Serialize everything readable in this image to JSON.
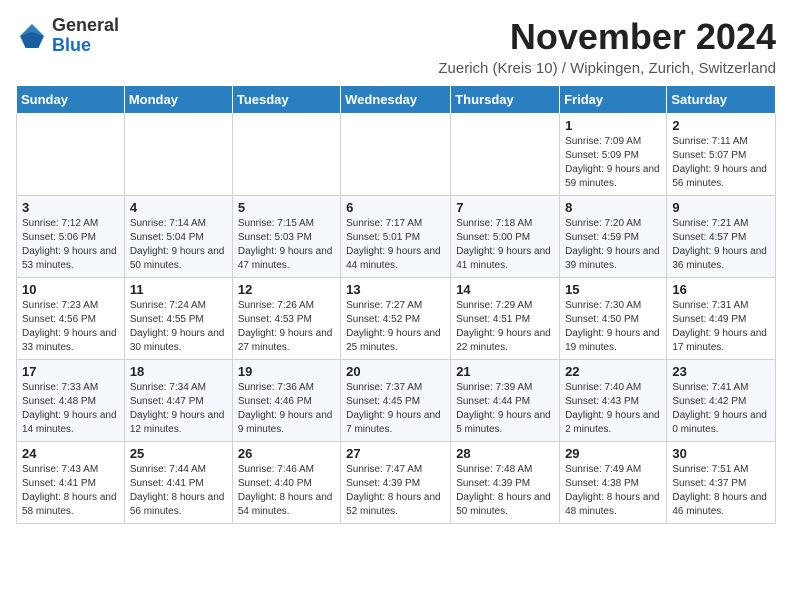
{
  "header": {
    "logo_general": "General",
    "logo_blue": "Blue",
    "month_title": "November 2024",
    "subtitle": "Zuerich (Kreis 10) / Wipkingen, Zurich, Switzerland"
  },
  "days_of_week": [
    "Sunday",
    "Monday",
    "Tuesday",
    "Wednesday",
    "Thursday",
    "Friday",
    "Saturday"
  ],
  "weeks": [
    [
      {
        "day": "",
        "info": ""
      },
      {
        "day": "",
        "info": ""
      },
      {
        "day": "",
        "info": ""
      },
      {
        "day": "",
        "info": ""
      },
      {
        "day": "",
        "info": ""
      },
      {
        "day": "1",
        "info": "Sunrise: 7:09 AM\nSunset: 5:09 PM\nDaylight: 9 hours and 59 minutes."
      },
      {
        "day": "2",
        "info": "Sunrise: 7:11 AM\nSunset: 5:07 PM\nDaylight: 9 hours and 56 minutes."
      }
    ],
    [
      {
        "day": "3",
        "info": "Sunrise: 7:12 AM\nSunset: 5:06 PM\nDaylight: 9 hours and 53 minutes."
      },
      {
        "day": "4",
        "info": "Sunrise: 7:14 AM\nSunset: 5:04 PM\nDaylight: 9 hours and 50 minutes."
      },
      {
        "day": "5",
        "info": "Sunrise: 7:15 AM\nSunset: 5:03 PM\nDaylight: 9 hours and 47 minutes."
      },
      {
        "day": "6",
        "info": "Sunrise: 7:17 AM\nSunset: 5:01 PM\nDaylight: 9 hours and 44 minutes."
      },
      {
        "day": "7",
        "info": "Sunrise: 7:18 AM\nSunset: 5:00 PM\nDaylight: 9 hours and 41 minutes."
      },
      {
        "day": "8",
        "info": "Sunrise: 7:20 AM\nSunset: 4:59 PM\nDaylight: 9 hours and 39 minutes."
      },
      {
        "day": "9",
        "info": "Sunrise: 7:21 AM\nSunset: 4:57 PM\nDaylight: 9 hours and 36 minutes."
      }
    ],
    [
      {
        "day": "10",
        "info": "Sunrise: 7:23 AM\nSunset: 4:56 PM\nDaylight: 9 hours and 33 minutes."
      },
      {
        "day": "11",
        "info": "Sunrise: 7:24 AM\nSunset: 4:55 PM\nDaylight: 9 hours and 30 minutes."
      },
      {
        "day": "12",
        "info": "Sunrise: 7:26 AM\nSunset: 4:53 PM\nDaylight: 9 hours and 27 minutes."
      },
      {
        "day": "13",
        "info": "Sunrise: 7:27 AM\nSunset: 4:52 PM\nDaylight: 9 hours and 25 minutes."
      },
      {
        "day": "14",
        "info": "Sunrise: 7:29 AM\nSunset: 4:51 PM\nDaylight: 9 hours and 22 minutes."
      },
      {
        "day": "15",
        "info": "Sunrise: 7:30 AM\nSunset: 4:50 PM\nDaylight: 9 hours and 19 minutes."
      },
      {
        "day": "16",
        "info": "Sunrise: 7:31 AM\nSunset: 4:49 PM\nDaylight: 9 hours and 17 minutes."
      }
    ],
    [
      {
        "day": "17",
        "info": "Sunrise: 7:33 AM\nSunset: 4:48 PM\nDaylight: 9 hours and 14 minutes."
      },
      {
        "day": "18",
        "info": "Sunrise: 7:34 AM\nSunset: 4:47 PM\nDaylight: 9 hours and 12 minutes."
      },
      {
        "day": "19",
        "info": "Sunrise: 7:36 AM\nSunset: 4:46 PM\nDaylight: 9 hours and 9 minutes."
      },
      {
        "day": "20",
        "info": "Sunrise: 7:37 AM\nSunset: 4:45 PM\nDaylight: 9 hours and 7 minutes."
      },
      {
        "day": "21",
        "info": "Sunrise: 7:39 AM\nSunset: 4:44 PM\nDaylight: 9 hours and 5 minutes."
      },
      {
        "day": "22",
        "info": "Sunrise: 7:40 AM\nSunset: 4:43 PM\nDaylight: 9 hours and 2 minutes."
      },
      {
        "day": "23",
        "info": "Sunrise: 7:41 AM\nSunset: 4:42 PM\nDaylight: 9 hours and 0 minutes."
      }
    ],
    [
      {
        "day": "24",
        "info": "Sunrise: 7:43 AM\nSunset: 4:41 PM\nDaylight: 8 hours and 58 minutes."
      },
      {
        "day": "25",
        "info": "Sunrise: 7:44 AM\nSunset: 4:41 PM\nDaylight: 8 hours and 56 minutes."
      },
      {
        "day": "26",
        "info": "Sunrise: 7:46 AM\nSunset: 4:40 PM\nDaylight: 8 hours and 54 minutes."
      },
      {
        "day": "27",
        "info": "Sunrise: 7:47 AM\nSunset: 4:39 PM\nDaylight: 8 hours and 52 minutes."
      },
      {
        "day": "28",
        "info": "Sunrise: 7:48 AM\nSunset: 4:39 PM\nDaylight: 8 hours and 50 minutes."
      },
      {
        "day": "29",
        "info": "Sunrise: 7:49 AM\nSunset: 4:38 PM\nDaylight: 8 hours and 48 minutes."
      },
      {
        "day": "30",
        "info": "Sunrise: 7:51 AM\nSunset: 4:37 PM\nDaylight: 8 hours and 46 minutes."
      }
    ]
  ]
}
